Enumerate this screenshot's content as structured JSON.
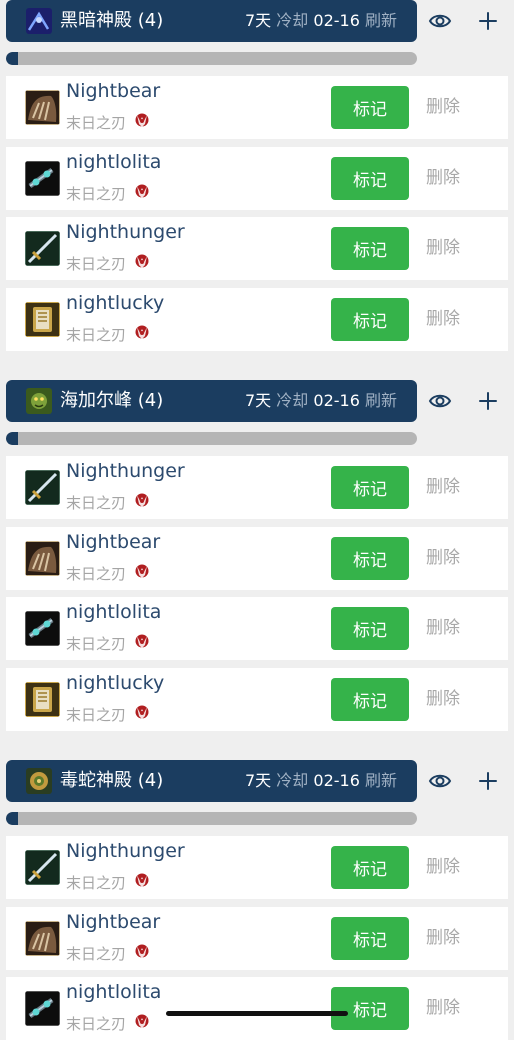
{
  "colors": {
    "header_bg": "#1b3d60",
    "mark_button": "#35b34a",
    "progress_track": "#b5b5b5",
    "name_text": "#2c4a6e",
    "muted_text": "#a5a5a5"
  },
  "icons": {
    "visibility": "eye-icon",
    "add": "plus-icon",
    "faction": "horde-icon"
  },
  "sections": [
    {
      "raid_name": "黑暗神殿 (4)",
      "cooldown_days": "7天",
      "cooldown_label": "冷却",
      "refresh_date": "02-16",
      "refresh_label": "刷新",
      "progress": 0.03,
      "characters": [
        {
          "name": "Nightbear",
          "realm": "末日之刃",
          "mark_label": "标记",
          "delete_label": "删除"
        },
        {
          "name": "nightlolita",
          "realm": "末日之刃",
          "mark_label": "标记",
          "delete_label": "删除"
        },
        {
          "name": "Nighthunger",
          "realm": "末日之刃",
          "mark_label": "标记",
          "delete_label": "删除"
        },
        {
          "name": "nightlucky",
          "realm": "末日之刃",
          "mark_label": "标记",
          "delete_label": "删除"
        }
      ]
    },
    {
      "raid_name": "海加尔峰 (4)",
      "cooldown_days": "7天",
      "cooldown_label": "冷却",
      "refresh_date": "02-16",
      "refresh_label": "刷新",
      "progress": 0.03,
      "characters": [
        {
          "name": "Nighthunger",
          "realm": "末日之刃",
          "mark_label": "标记",
          "delete_label": "删除"
        },
        {
          "name": "Nightbear",
          "realm": "末日之刃",
          "mark_label": "标记",
          "delete_label": "删除"
        },
        {
          "name": "nightlolita",
          "realm": "末日之刃",
          "mark_label": "标记",
          "delete_label": "删除"
        },
        {
          "name": "nightlucky",
          "realm": "末日之刃",
          "mark_label": "标记",
          "delete_label": "删除"
        }
      ]
    },
    {
      "raid_name": "毒蛇神殿 (4)",
      "cooldown_days": "7天",
      "cooldown_label": "冷却",
      "refresh_date": "02-16",
      "refresh_label": "刷新",
      "progress": 0.03,
      "characters": [
        {
          "name": "Nighthunger",
          "realm": "末日之刃",
          "mark_label": "标记",
          "delete_label": "删除"
        },
        {
          "name": "Nightbear",
          "realm": "末日之刃",
          "mark_label": "标记",
          "delete_label": "删除"
        },
        {
          "name": "nightlolita",
          "realm": "末日之刃",
          "mark_label": "标记",
          "delete_label": "删除"
        }
      ]
    }
  ]
}
